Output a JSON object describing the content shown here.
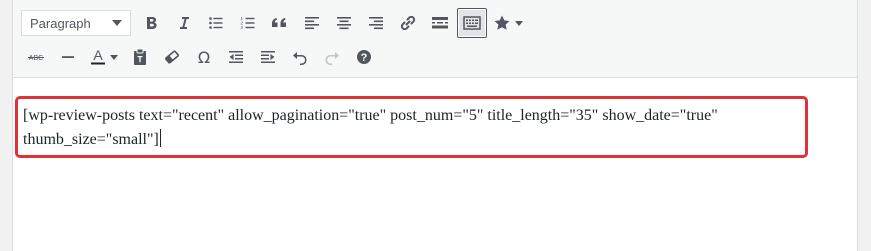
{
  "toolbar": {
    "format_select": {
      "value": "Paragraph"
    },
    "row1_icons": [
      "bold-icon",
      "italic-icon",
      "bulleted-list-icon",
      "numbered-list-icon",
      "blockquote-icon",
      "align-left-icon",
      "align-center-icon",
      "align-right-icon",
      "link-icon",
      "read-more-icon",
      "toolbar-toggle-icon",
      "star-icon"
    ],
    "row2_icons": [
      "strikethrough-icon",
      "horizontal-line-icon",
      "text-color-icon",
      "paste-as-text-icon",
      "clear-formatting-icon",
      "special-character-icon",
      "decrease-indent-icon",
      "increase-indent-icon",
      "undo-icon",
      "redo-icon",
      "help-icon"
    ],
    "strikethrough_glyph": "ABC",
    "text_color_glyph": "A",
    "special_char_glyph": "Ω",
    "help_glyph": "?"
  },
  "content": {
    "shortcode_text": "[wp-review-posts text=\"recent\" allow_pagination=\"true\" post_num=\"5\" title_length=\"35\" show_date=\"true\" thumb_size=\"small\"]"
  },
  "colors": {
    "highlight_border": "#e0313b",
    "icon_color": "#50575e"
  }
}
